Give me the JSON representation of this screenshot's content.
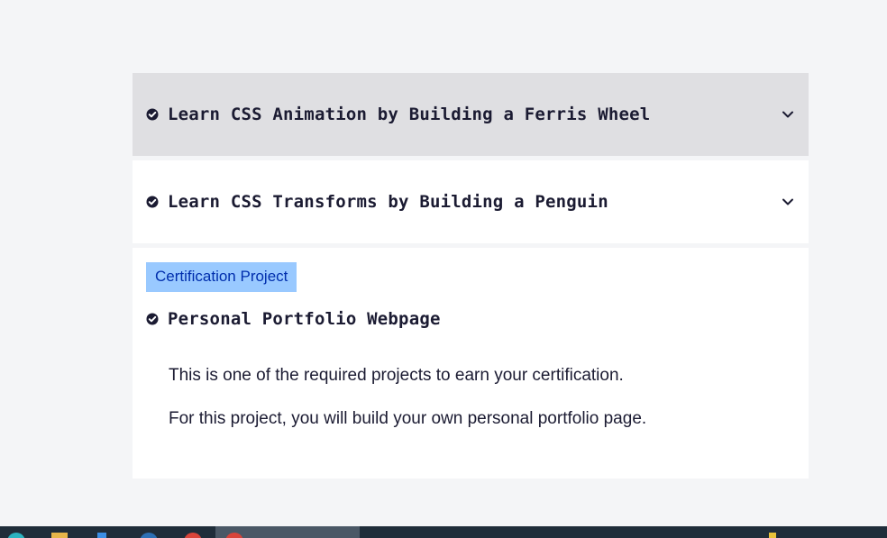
{
  "blocks": [
    {
      "title": "Learn CSS Animation by Building a Ferris Wheel",
      "completed": true,
      "expanded": false,
      "state": "hovered"
    },
    {
      "title": "Learn CSS Transforms by Building a Penguin",
      "completed": true,
      "expanded": false,
      "state": "default"
    }
  ],
  "certification": {
    "badge": "Certification Project",
    "title": "Personal Portfolio Webpage",
    "completed": true,
    "description": [
      "This is one of the required projects to earn your certification.",
      "For this project, you will build your own personal portfolio page."
    ]
  },
  "icons": {
    "check": "check-circle-icon",
    "chevron": "chevron-down-icon"
  },
  "colors": {
    "background": "#f4f5f7",
    "hover_block": "#dfdfe2",
    "text": "#1b1b32",
    "badge_bg": "#99c9ff",
    "badge_text": "#002ead",
    "taskbar": "#1f2d3a"
  }
}
